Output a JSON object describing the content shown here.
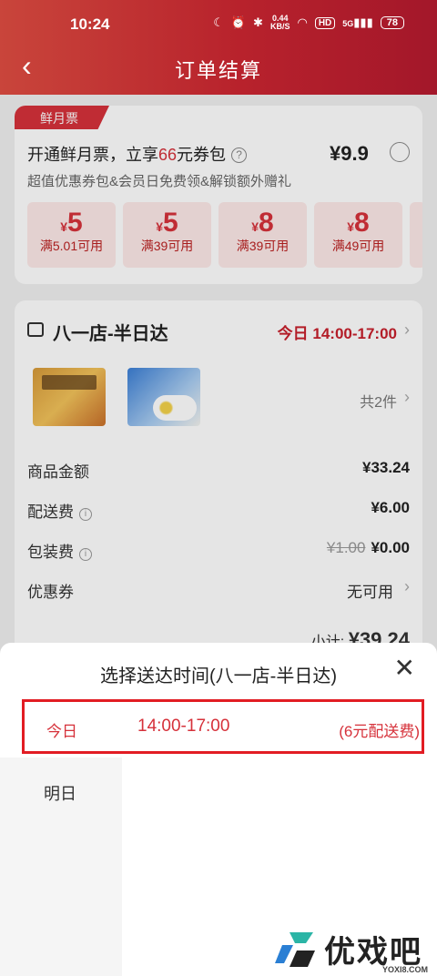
{
  "status_bar": {
    "time": "10:24",
    "net_speed": "0.44",
    "net_unit": "KB/S",
    "hd": "HD",
    "signal": "5G",
    "battery": "78"
  },
  "nav": {
    "title": "订单结算"
  },
  "vip": {
    "tag": "鲜月票",
    "title_prefix": "开通鲜月票，立享",
    "title_highlight": "66",
    "title_suffix": "元券包",
    "price": "¥9.9",
    "subtitle": "超值优惠券包&会员日免费领&解锁额外赠礼",
    "coupons": [
      {
        "symbol": "¥",
        "amount": "5",
        "condition": "满5.01可用"
      },
      {
        "symbol": "¥",
        "amount": "5",
        "condition": "满39可用"
      },
      {
        "symbol": "¥",
        "amount": "8",
        "condition": "满39可用"
      },
      {
        "symbol": "¥",
        "amount": "8",
        "condition": "满49可用"
      }
    ]
  },
  "order": {
    "store_name": "八一店-半日达",
    "delivery_time": "今日 14:00-17:00",
    "item_count": "共2件",
    "rows": [
      {
        "label": "商品金额",
        "value": "¥33.24"
      },
      {
        "label": "配送费",
        "value": "¥6.00"
      },
      {
        "label": "包装费",
        "old_value": "¥1.00",
        "value": "¥0.00"
      },
      {
        "label": "优惠券",
        "value": "无可用"
      }
    ],
    "subtotal_label": "小计:",
    "subtotal_value": "¥39.24"
  },
  "sheet": {
    "title": "选择送达时间(八一店-半日达)",
    "selected": {
      "day": "今日",
      "slot": "14:00-17:00",
      "fee": "(6元配送费)"
    },
    "days": [
      "今日",
      "明日"
    ]
  },
  "watermark": {
    "text": "优戏吧",
    "url": "YOXI8.COM"
  },
  "colors": {
    "brand_red": "#d6313a",
    "highlight_border": "#e21c23"
  }
}
